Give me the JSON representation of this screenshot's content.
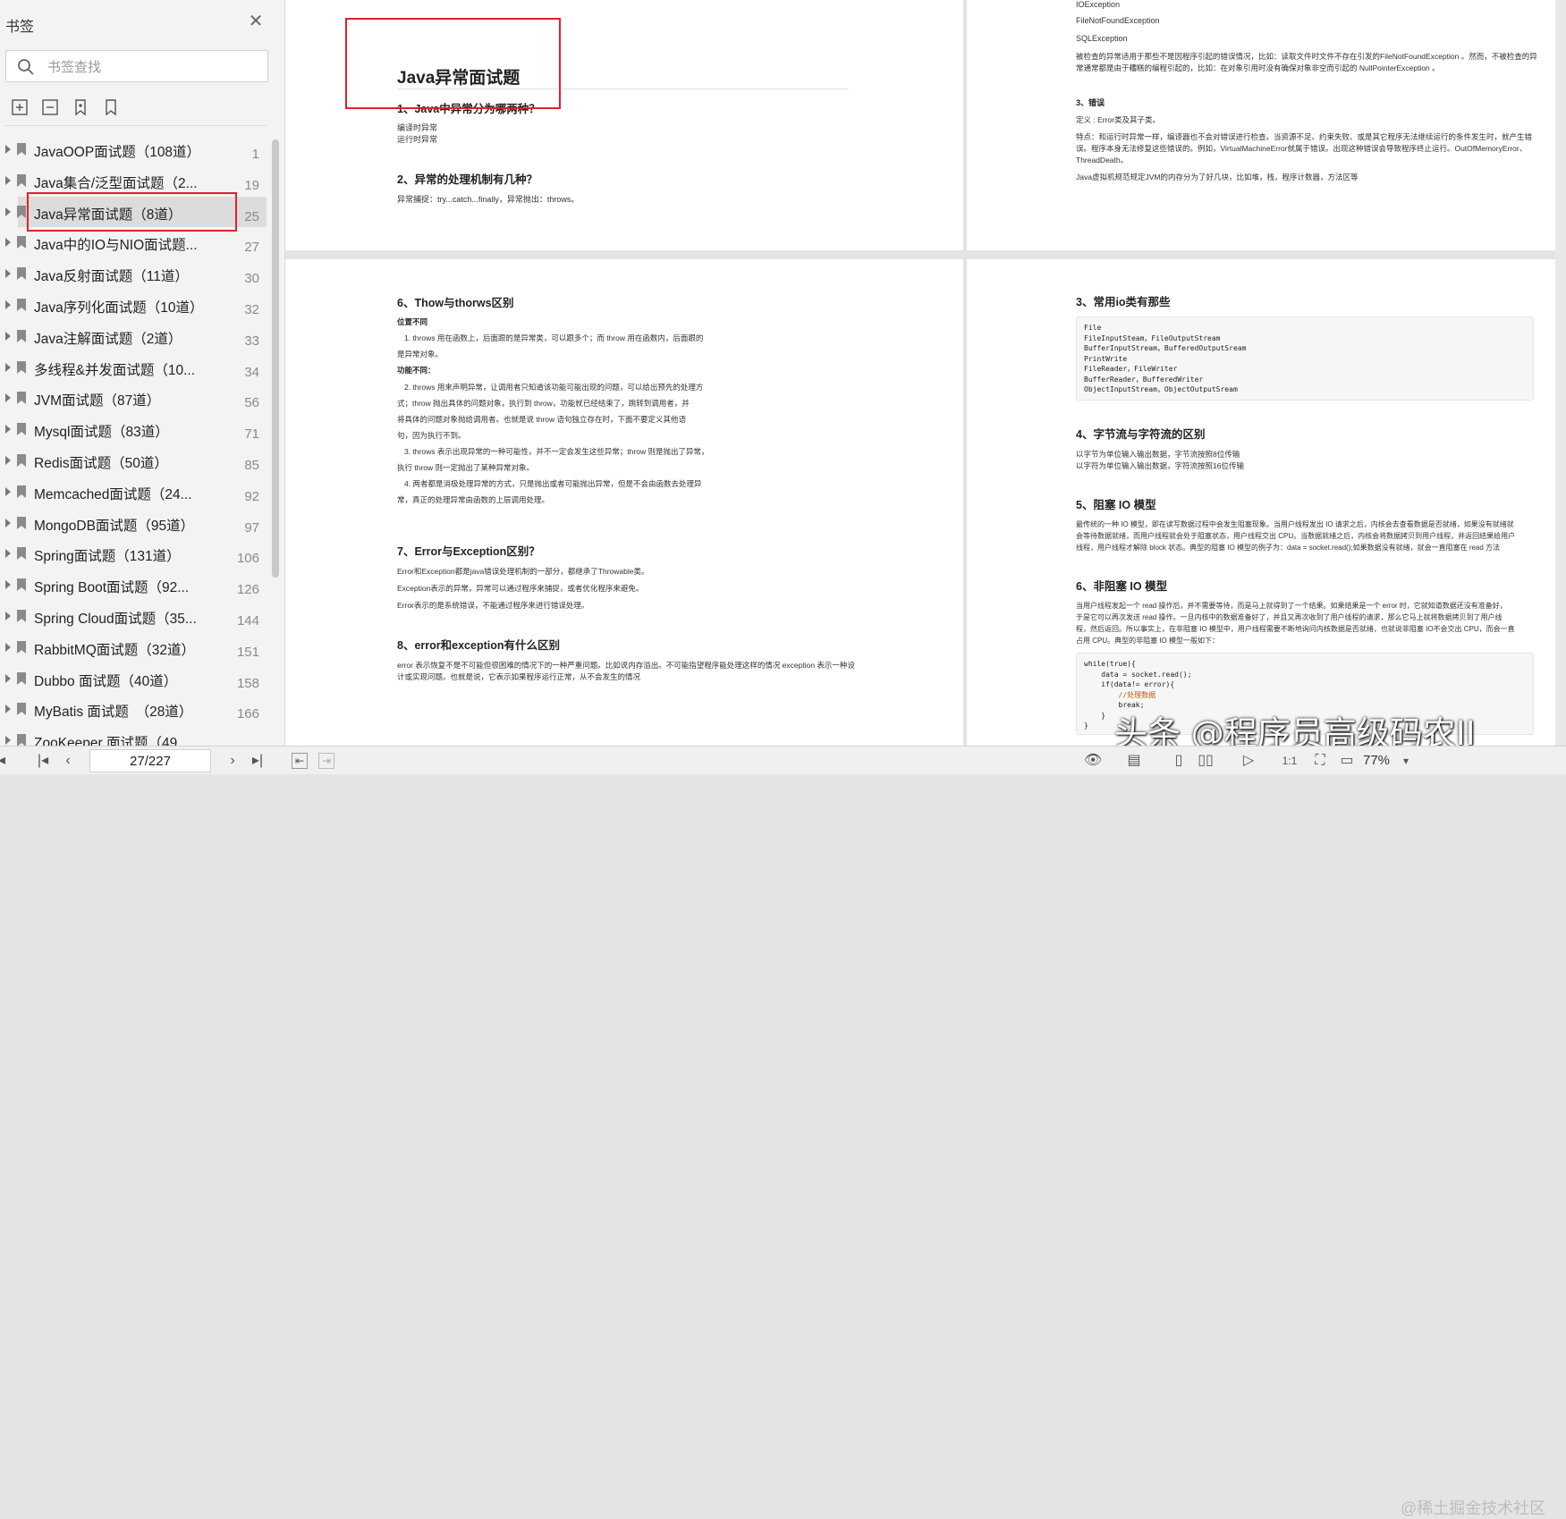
{
  "sidebar": {
    "title": "书签",
    "search_placeholder": "书签查找",
    "items": [
      {
        "label": "JavaOOP面试题（108道）",
        "page": "1"
      },
      {
        "label": "Java集合/泛型面试题（2...",
        "page": "19"
      },
      {
        "label": "Java异常面试题（8道）",
        "page": "25",
        "active": true
      },
      {
        "label": "Java中的IO与NIO面试题...",
        "page": "27"
      },
      {
        "label": "Java反射面试题（11道）",
        "page": "30"
      },
      {
        "label": "Java序列化面试题（10道）",
        "page": "32"
      },
      {
        "label": "Java注解面试题（2道）",
        "page": "33"
      },
      {
        "label": "多线程&并发面试题（10...",
        "page": "34"
      },
      {
        "label": "JVM面试题（87道）",
        "page": "56"
      },
      {
        "label": "Mysql面试题（83道）",
        "page": "71"
      },
      {
        "label": "Redis面试题（50道）",
        "page": "85"
      },
      {
        "label": "Memcached面试题（24...",
        "page": "92"
      },
      {
        "label": "MongoDB面试题（95道）",
        "page": "97"
      },
      {
        "label": "Spring面试题（131道）",
        "page": "106"
      },
      {
        "label": "Spring Boot面试题（92...",
        "page": "126"
      },
      {
        "label": "Spring Cloud面试题（35...",
        "page": "144"
      },
      {
        "label": "RabbitMQ面试题（32道）",
        "page": "151"
      },
      {
        "label": "Dubbo 面试题（40道）",
        "page": "158"
      },
      {
        "label": "MyBatis 面试题　（28道）",
        "page": "166"
      },
      {
        "label": "ZooKeeper 面试题（49",
        "page": ""
      }
    ]
  },
  "page_left_top": {
    "title": "Java异常面试题",
    "q1": "1、Java中异常分为哪两种？",
    "q1_a1": "编译时异常",
    "q1_a2": "运行时异常",
    "q2": "2、异常的处理机制有几种？",
    "q2_a": "异常捕捉：try...catch...finally，异常抛出：throws。"
  },
  "page_right_top": {
    "l1": "IOException",
    "l2": "FileNotFoundException",
    "l3": "SQLException",
    "p1a": "被检查的异常适用于那些不是因程序引起的错误情况，比如：读取文件时文件不存在引发的FileNotFoundException 。然而，不被检查的异",
    "p1b": "常通常都是由于糟糕的编程引起的，比如：在对象引用时没有确保对象非空而引起的 NullPointerException 。",
    "h3": "3、错误",
    "def": "定义 : Error类及其子类。",
    "p2a": "特点：和运行时异常一样，编译器也不会对错误进行检查。当资源不足、约束失败、或是其它程序无法继续运行的条件发生时，就产生错",
    "p2b": "误。程序本身无法修复这些错误的。例如，VirtualMachineError就属于错误。出现这种错误会导致程序终止运行。OutOfMemoryError、",
    "p2c": "ThreadDeath。",
    "p3": "Java虚拟机规范规定JVM的内存分为了好几块，比如堆，栈，程序计数器，方法区等"
  },
  "page_left_bottom": {
    "q6": "6、Thow与thorws区别",
    "pos": "位置不同",
    "p1a": "1. throws 用在函数上，后面跟的是异常类，可以跟多个；而 throw 用在函数内，后面跟的",
    "p1b": "是异常对象。",
    "func": "功能不同：",
    "p2a": "2. throws 用来声明异常，让调用者只知道该功能可能出现的问题，可以给出预先的处理方",
    "p2b": "式；throw 抛出具体的问题对象，执行到 throw，功能就已经结束了，跳转到调用者，并",
    "p2c": "将具体的问题对象抛给调用者。也就是说 throw 语句独立存在时，下面不要定义其他语",
    "p2d": "句，因为执行不到。",
    "p3a": "3. throws 表示出现异常的一种可能性，并不一定会发生这些异常；throw 则是抛出了异常，",
    "p3b": "执行 throw 则一定抛出了某种异常对象。",
    "p4a": "4. 两者都是消极处理异常的方式，只是抛出或者可能抛出异常，但是不会由函数去处理异",
    "p4b": "常，真正的处理异常由函数的上层调用处理。",
    "q7": "7、Error与Exception区别？",
    "e1": "Error和Exception都是java错误处理机制的一部分，都继承了Throwable类。",
    "e2": "Exception表示的异常，异常可以通过程序来捕捉，或者优化程序来避免。",
    "e3": "Error表示的是系统错误，不能通过程序来进行错误处理。",
    "q8": "8、error和exception有什么区别",
    "e4a": " error 表示恢复不是不可能但很困难的情况下的一种严重问题。比如说内存溢出。不可能指望程序能处理这样的情况 exception 表示一种设",
    "e4b": "计或实现问题。也就是说，它表示如果程序运行正常，从不会发生的情况"
  },
  "page_right_bottom": {
    "q3": "3、常用io类有那些",
    "code": [
      "File",
      "FileInputSteam，FileOutputStream",
      "BufferInputStream，BufferedOutputSream",
      "PrintWrite",
      "FileReader，FileWriter",
      "BufferReader，BufferedWriter",
      "ObjectInputStream，ObjectOutputSream"
    ],
    "q4": "4、字节流与字符流的区别",
    "q4a": "以字节为单位输入输出数据，字节流按照8位传输",
    "q4b": "以字符为单位输入输出数据，字符流按照16位传输",
    "q5": "5、阻塞 IO 模型",
    "q5a": "最传统的一种 IO 模型，即在读写数据过程中会发生阻塞现象。当用户线程发出 IO 请求之后，内核会去查看数据是否就绪，如果没有就绪就",
    "q5b": "会等待数据就绪，而用户线程就会处于阻塞状态，用户线程交出 CPU。当数据就绪之后，内核会将数据拷贝到用户线程，并返回结果给用户",
    "q5c": "线程，用户线程才解除 block 状态。典型的阻塞 IO 模型的例子为：data = socket.read();如果数据没有就绪，就会一直阻塞在 read 方法",
    "q6": "6、非阻塞 IO 模型",
    "q6a": "当用户线程发起一个 read 操作后，并不需要等待，而是马上就得到了一个结果。如果结果是一个 error 时，它就知道数据还没有准备好，",
    "q6b": "于是它可以再次发送 read 操作。一旦内核中的数据准备好了，并且又再次收到了用户线程的请求，那么它马上就将数据拷贝到了用户线",
    "q6c": "程，然后返回。所以事实上，在非阻塞 IO 模型中，用户线程需要不断地询问内核数据是否就绪，也就说非阻塞 IO不会交出 CPU，而会一直",
    "q6d": "占用 CPU。典型的非阻塞 IO 模型一般如下：",
    "code2": [
      "while(true){",
      "    data = socket.read();",
      "    if(data!= error){",
      "        //处理数据",
      "        break;",
      "    }",
      "}"
    ]
  },
  "status": {
    "page": "27/227",
    "zoom": "77%"
  },
  "watermark": "头条 @程序员高级码农II",
  "watermark2": "@稀土掘金技术社区"
}
